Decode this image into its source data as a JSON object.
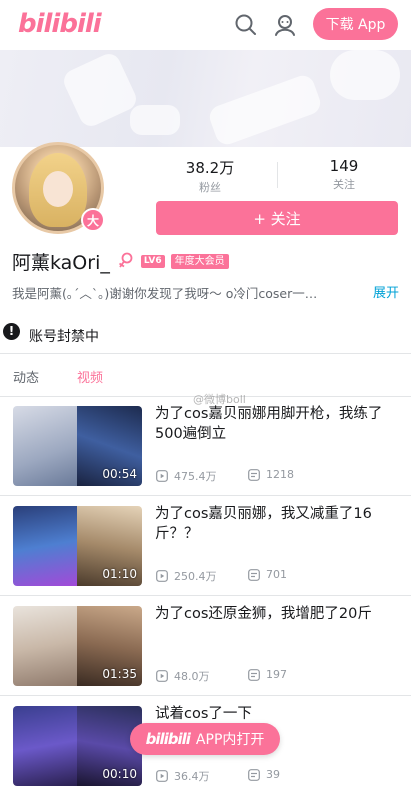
{
  "header": {
    "logo_text": "bilibili",
    "download_label": "下载 App",
    "icons": [
      "search-icon",
      "user-icon"
    ]
  },
  "profile": {
    "fans_count": "38.2万",
    "fans_label": "粉丝",
    "follow_count": "149",
    "follow_label": "关注",
    "follow_button_label": "+ 关注",
    "vip_badge_text": "大",
    "username": "阿薰kaOri_",
    "level_badge": "LV6",
    "vip_tag": "年度大会员",
    "bio": "我是阿薰(｡ˊ︿ˋ｡)谢谢你发现了我呀～ o冷门coser一…",
    "expand_label": "展开",
    "ban_notice": "账号封禁中"
  },
  "tabs": [
    {
      "label": "动态",
      "active": false
    },
    {
      "label": "视频",
      "active": true
    }
  ],
  "watermark": "@微博boll",
  "videos": [
    {
      "title": "为了cos嘉贝丽娜用脚开枪，我练了500遍倒立",
      "duration": "00:54",
      "plays": "475.4万",
      "danmaku": "1218"
    },
    {
      "title": "为了cos嘉贝丽娜，我又减重了16斤？？",
      "duration": "01:10",
      "plays": "250.4万",
      "danmaku": "701"
    },
    {
      "title": "为了cos还原金狮，我增肥了20斤",
      "duration": "01:35",
      "plays": "48.0万",
      "danmaku": "197"
    },
    {
      "title": "试着cos了一下",
      "duration": "00:10",
      "plays": "36.4万",
      "danmaku": "39"
    }
  ],
  "open_app": {
    "logo_text": "bilibili",
    "label": "APP内打开"
  },
  "colors": {
    "accent": "#fb7299",
    "link": "#00a1d6"
  }
}
